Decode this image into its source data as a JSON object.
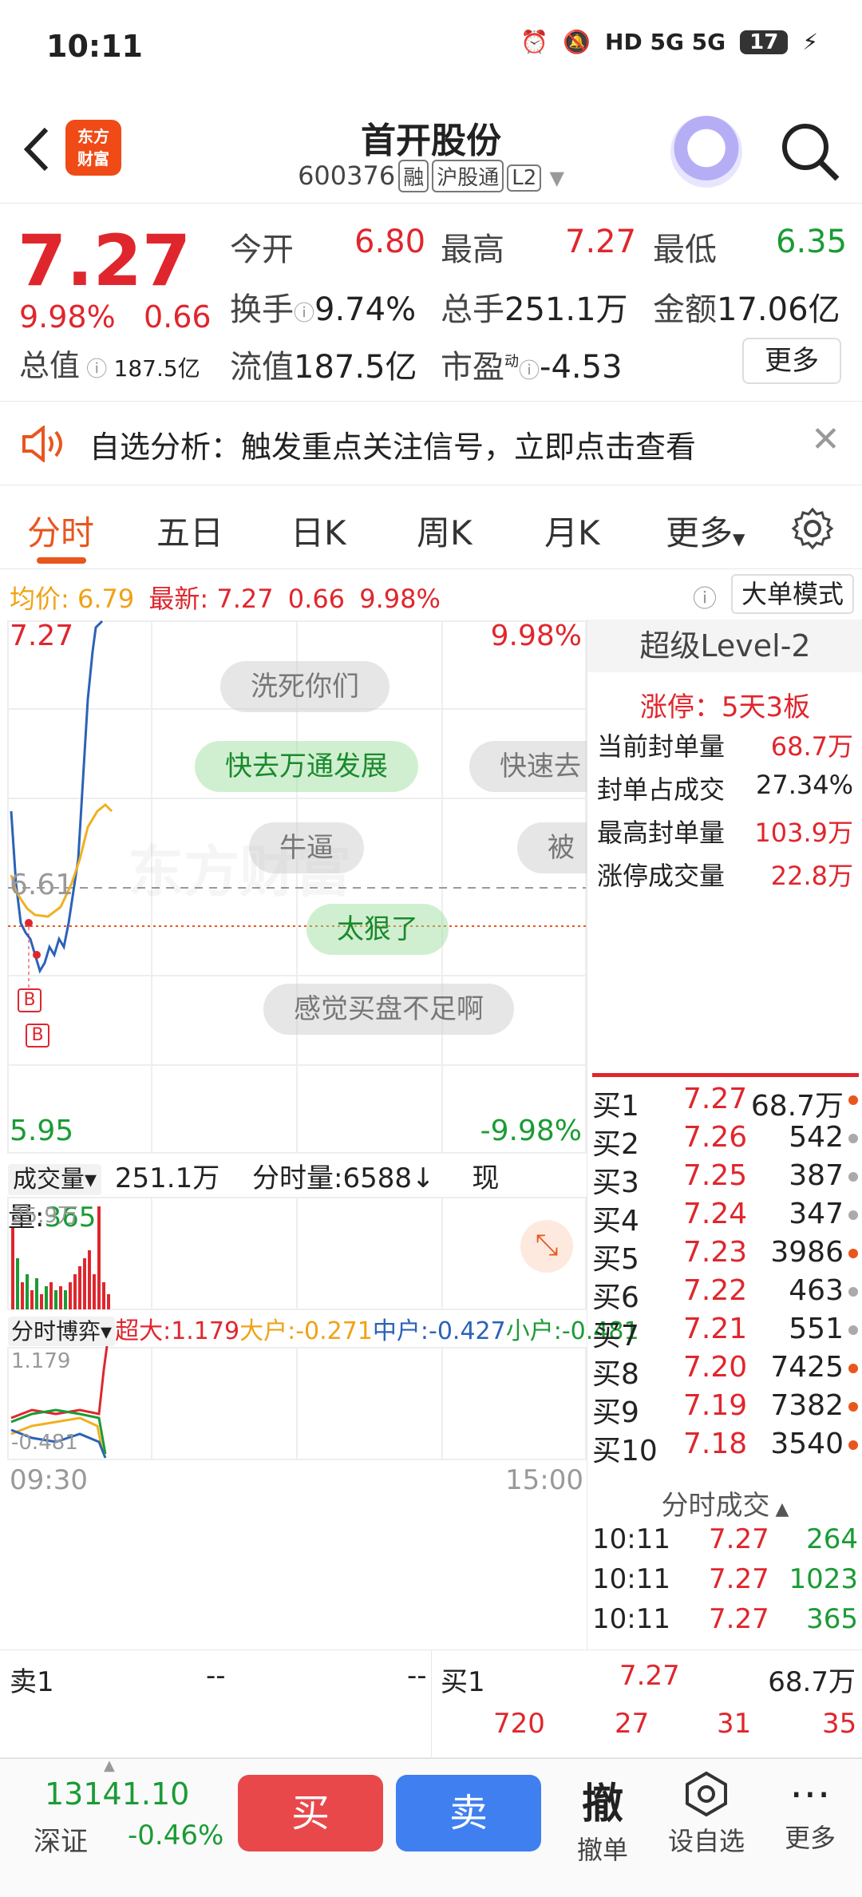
{
  "status_bar": {
    "time": "10:11",
    "icons_text": "HD 5G 5G",
    "battery": "17"
  },
  "header": {
    "logo_line1": "东方",
    "logo_line2": "财富",
    "title": "首开股份",
    "code": "600376",
    "tag_rong": "融",
    "tag_hgt": "沪股通",
    "tag_l2": "L2"
  },
  "quote": {
    "price": "7.27",
    "change_pct": "9.98%",
    "change": "0.66",
    "open_label": "今开",
    "open": "6.80",
    "high_label": "最高",
    "high": "7.27",
    "low_label": "最低",
    "low": "6.35",
    "turnover_label": "换手",
    "turnover": "9.74%",
    "volume_label": "总手",
    "volume": "251.1万",
    "amount_label": "金额",
    "amount": "17.06亿",
    "mcap_label": "总值",
    "mcap": "187.5亿",
    "float_label": "流值",
    "float": "187.5亿",
    "pe_label": "市盈",
    "pe_sup": "动",
    "pe": "-4.53",
    "more_label": "更多"
  },
  "notice": {
    "text": "自选分析：触发重点关注信号，立即点击查看"
  },
  "tabs": [
    "分时",
    "五日",
    "日K",
    "周K",
    "月K",
    "更多"
  ],
  "infobar": {
    "avg_label": "均价:",
    "avg": "6.79",
    "latest_label": "最新:",
    "latest": "7.27",
    "chg": "0.66",
    "pct": "9.98%",
    "mode": "大单模式"
  },
  "chart": {
    "y_top": "7.27",
    "pct_top": "9.98%",
    "y_mid": "6.61",
    "y_bottom": "5.95",
    "pct_bottom": "-9.98%",
    "marker_b": "B",
    "watermark": "东方财富",
    "danmu": [
      "洗死你们",
      "快去万通发展",
      "快速去",
      "牛逼",
      "被",
      "太狠了",
      "感觉买盘不足啊"
    ]
  },
  "volume": {
    "label": "成交量",
    "total": "251.1万",
    "tick_label": "分时量:",
    "tick": "6588",
    "now_label": "现量:",
    "now": "365",
    "max": "25.9万"
  },
  "flow": {
    "label": "分时博弈",
    "super_label": "超大:",
    "super": "1.179",
    "big_label": "大户:",
    "big": "-0.271",
    "mid_label": "中户:",
    "mid": "-0.427",
    "small_label": "小户:",
    "small": "-0.481",
    "max": "1.179",
    "min": "-0.481"
  },
  "time_axis": {
    "start": "09:30",
    "end": "15:00"
  },
  "level2": {
    "title": "超级Level-2",
    "limit_label": "涨停：",
    "limit": "5天3板",
    "stats": [
      {
        "label": "当前封单量",
        "value": "68.7万"
      },
      {
        "label": "封单占成交",
        "value": "27.34%"
      },
      {
        "label": "最高封单量",
        "value": "103.9万"
      },
      {
        "label": "涨停成交量",
        "value": "22.8万"
      }
    ]
  },
  "bids": [
    {
      "label": "买1",
      "price": "7.27",
      "vol": "68.7万",
      "dot": "#e8561e"
    },
    {
      "label": "买2",
      "price": "7.26",
      "vol": "542",
      "dot": "#aaaaaa"
    },
    {
      "label": "买3",
      "price": "7.25",
      "vol": "387",
      "dot": "#aaaaaa"
    },
    {
      "label": "买4",
      "price": "7.24",
      "vol": "347",
      "dot": "#aaaaaa"
    },
    {
      "label": "买5",
      "price": "7.23",
      "vol": "3986",
      "dot": "#e8561e"
    },
    {
      "label": "买6",
      "price": "7.22",
      "vol": "463",
      "dot": "#aaaaaa"
    },
    {
      "label": "买7",
      "price": "7.21",
      "vol": "551",
      "dot": "#aaaaaa"
    },
    {
      "label": "买8",
      "price": "7.20",
      "vol": "7425",
      "dot": "#e8561e"
    },
    {
      "label": "买9",
      "price": "7.19",
      "vol": "7382",
      "dot": "#e8561e"
    },
    {
      "label": "买10",
      "price": "7.18",
      "vol": "3540",
      "dot": "#e8561e"
    }
  ],
  "ticks_title": "分时成交",
  "ticks": [
    {
      "time": "10:11",
      "price": "7.27",
      "vol": "264"
    },
    {
      "time": "10:11",
      "price": "7.27",
      "vol": "1023"
    },
    {
      "time": "10:11",
      "price": "7.27",
      "vol": "365"
    }
  ],
  "bottom_book": {
    "sell1_label": "卖1",
    "sell1_price": "--",
    "sell1_vol": "--",
    "buy1_label": "买1",
    "buy1_price": "7.27",
    "buy1_vol": "68.7万",
    "queue": [
      "720",
      "27",
      "31",
      "35"
    ]
  },
  "bottom": {
    "index_value": "13141.10",
    "index_name": "深证",
    "index_chg": "-0.46%",
    "buy": "买",
    "sell": "卖",
    "cancel_icon": "撤",
    "cancel": "撤单",
    "watch": "设自选",
    "more": "更多"
  }
}
